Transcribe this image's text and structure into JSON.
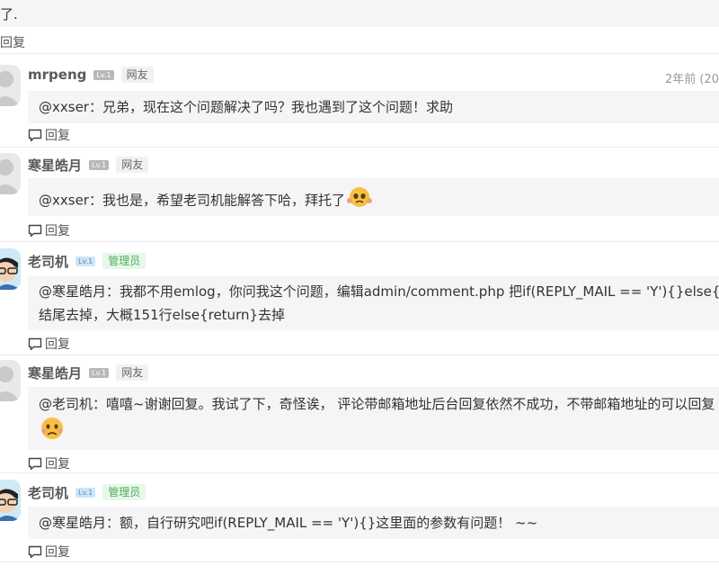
{
  "top_fragment": {
    "text": "了."
  },
  "reply_label": "回复",
  "comments": [
    {
      "name": "mrpeng",
      "level": "Lv.1",
      "role": "网友",
      "time": "2年前 (20",
      "content": [
        "@xxser：兄弟，现在这个问题解决了吗？我也遇到了这个问题！求助"
      ],
      "emoji": ""
    },
    {
      "name": "寒星皓月",
      "level": "Lv.1",
      "role": "网友",
      "time": "",
      "content": [
        "@xxser：我也是，希望老司机能解答下哈，拜托了"
      ],
      "emoji": "pleading-face-icon"
    },
    {
      "name": "老司机",
      "level": "Lv.1",
      "role": "管理员",
      "time": "",
      "content": [
        "@寒星皓月：我都不用emlog，你问我这个问题，编辑admin/comment.php 把if(REPLY_MAIL == 'Y'){}else{re",
        "结尾去掉，大概151行else{return}去掉"
      ],
      "emoji": ""
    },
    {
      "name": "寒星皓月",
      "level": "Lv.1",
      "role": "网友",
      "time": "",
      "content": [
        "@老司机：嘻嘻~谢谢回复。我试了下，奇怪诶， 评论带邮箱地址后台回复依然不成功，不带邮箱地址的可以回复"
      ],
      "emoji": "sad-face-icon"
    },
    {
      "name": "老司机",
      "level": "Lv.1",
      "role": "管理员",
      "time": "",
      "content": [
        "@寒星皓月：额，自行研究吧if(REPLY_MAIL == 'Y'){}这里面的参数有问题！ ~~"
      ],
      "emoji": ""
    }
  ],
  "colors": {
    "bubble": "#f5f5f7",
    "name": "#595959",
    "admin_badge": "#4fae5b",
    "time": "#999999"
  }
}
